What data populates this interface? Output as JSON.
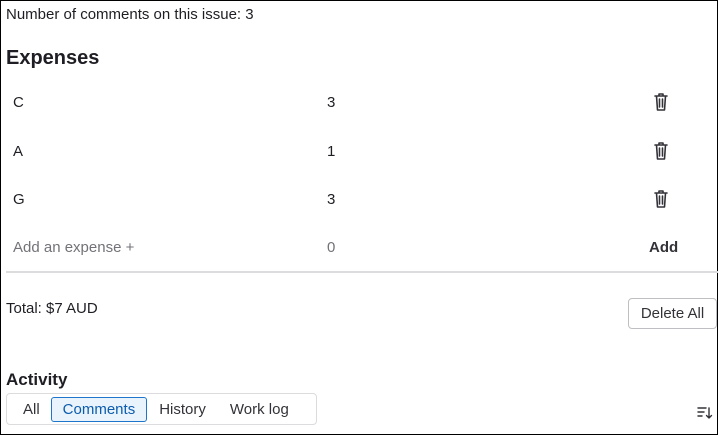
{
  "issue": {
    "comments_label": "Number of comments on this issue: 3"
  },
  "expenses": {
    "title": "Expenses",
    "items": [
      {
        "name": "C",
        "amount": "3",
        "icon": "trash-icon"
      },
      {
        "name": "A",
        "amount": "1",
        "icon": "trash-icon"
      },
      {
        "name": "G",
        "amount": "3",
        "icon": "trash-icon"
      }
    ],
    "new_item": {
      "name_placeholder": "Add an expense +",
      "amount_placeholder": "0",
      "add_label": "Add"
    },
    "total_label": "Total: $7 AUD",
    "delete_all_label": "Delete All"
  },
  "activity": {
    "title": "Activity",
    "tabs": [
      {
        "label": "All",
        "active": false
      },
      {
        "label": "Comments",
        "active": true
      },
      {
        "label": "History",
        "active": false
      },
      {
        "label": "Work log",
        "active": false
      }
    ],
    "sort_icon": "sort-lowest-icon"
  },
  "colors": {
    "accent": "#1f75cb",
    "active_tab_bg": "#e9f3fc",
    "placeholder": "#737278",
    "divider": "#dcdcde"
  }
}
